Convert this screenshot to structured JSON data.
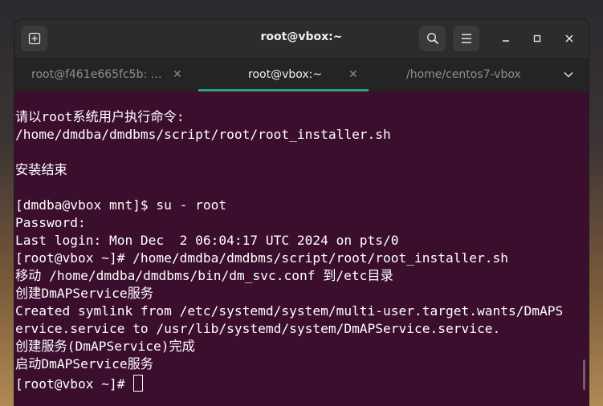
{
  "window": {
    "title": "root@vbox:~"
  },
  "tabs": [
    {
      "label": "root@f461e665fc5b: …",
      "active": false
    },
    {
      "label": "root@vbox:~",
      "active": true
    },
    {
      "label": "/home/centos7-vbox",
      "active": false
    }
  ],
  "icons": {
    "new_tab": "new-tab-icon",
    "search": "search-icon",
    "menu": "hamburger-menu-icon",
    "minimize": "minimize-icon",
    "maximize": "maximize-icon",
    "close": "close-icon",
    "tab_close": "close-icon",
    "tabs_dropdown": "chevron-down-icon"
  },
  "colors": {
    "terminal_bg": "#3b0e2e",
    "accent": "#2aa384"
  },
  "terminal": {
    "lines": [
      "请以root系统用户执行命令:",
      "/home/dmdba/dmdbms/script/root/root_installer.sh",
      "",
      "安装结束",
      "",
      "[dmdba@vbox mnt]$ su - root",
      "Password:",
      "Last login: Mon Dec  2 06:04:17 UTC 2024 on pts/0",
      "[root@vbox ~]# /home/dmdba/dmdbms/script/root/root_installer.sh",
      "移动 /home/dmdba/dmdbms/bin/dm_svc.conf 到/etc目录",
      "创建DmAPService服务",
      "Created symlink from /etc/systemd/system/multi-user.target.wants/DmAPS",
      "ervice.service to /usr/lib/systemd/system/DmAPService.service.",
      "创建服务(DmAPService)完成",
      "启动DmAPService服务"
    ],
    "prompt": "[root@vbox ~]# "
  }
}
